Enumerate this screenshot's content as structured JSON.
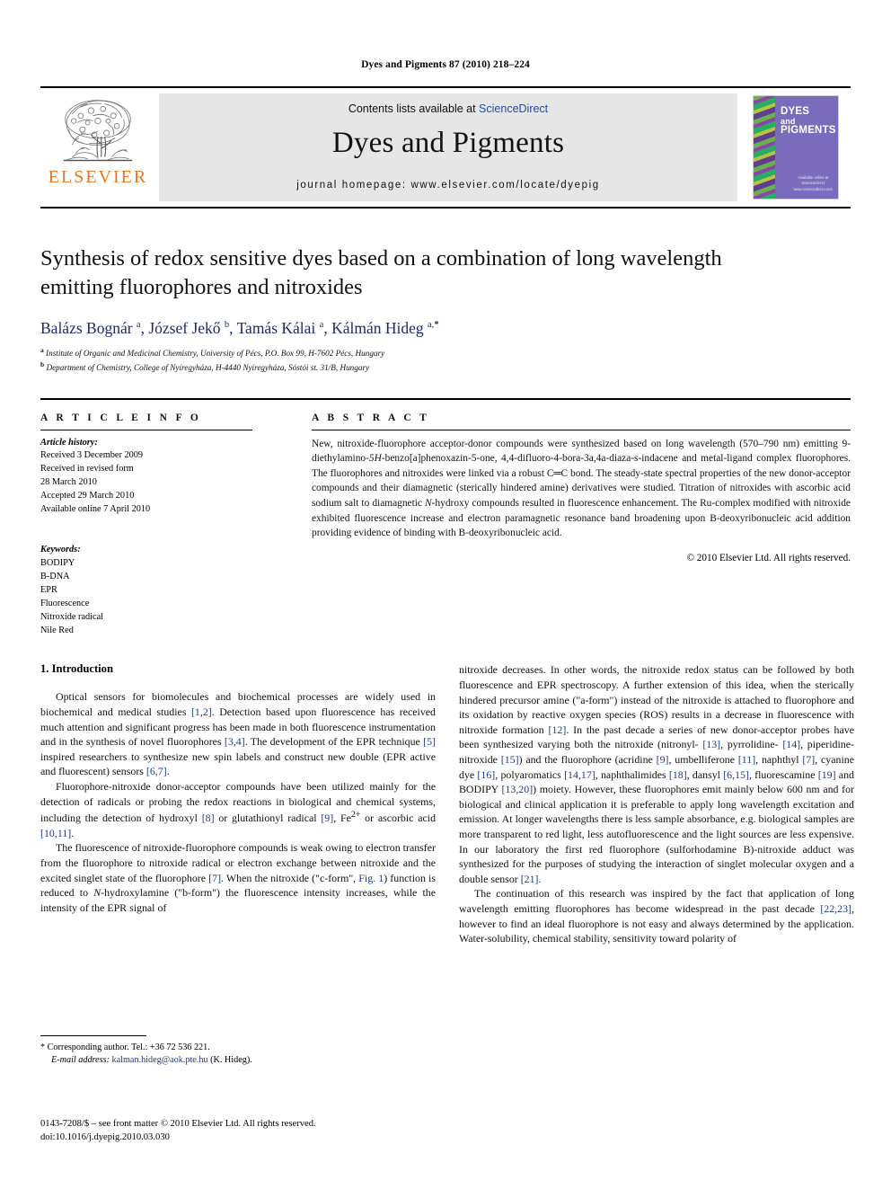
{
  "running_head": "Dyes and Pigments 87 (2010) 218–224",
  "masthead": {
    "publisher_logo_text": "ELSEVIER",
    "contents_prefix": "Contents lists available at ",
    "contents_link": "ScienceDirect",
    "journal_title": "Dyes and Pigments",
    "homepage": "journal homepage: www.elsevier.com/locate/dyepig",
    "cover": {
      "line1": "DYES",
      "line2": "and",
      "line3": "PIGMENTS",
      "footer1": "Available online at",
      "footer2": "ScienceDirect",
      "footer3": "www.sciencedirect.com"
    }
  },
  "article": {
    "title": "Synthesis of redox sensitive dyes based on a combination of long wavelength emitting fluorophores and nitroxides",
    "authors_html": "Balázs Bognár <sup>a</sup>, József Jekő <sup>b</sup>, Tamás Kálai <sup>a</sup>, Kálmán Hideg <sup>a,<b>*</b></sup>",
    "affiliation_a": "Institute of Organic and Medicinal Chemistry, University of Pécs, P.O. Box 99, H-7602 Pécs, Hungary",
    "affiliation_b": "Department of Chemistry, College of Nyíregyháza, H-4440 Nyíregyháza, Sóstói st. 31/B, Hungary"
  },
  "article_info": {
    "heading": "A R T I C L E   I N F O",
    "history_label": "Article history:",
    "history": [
      "Received 3 December 2009",
      "Received in revised form",
      "28 March 2010",
      "Accepted 29 March 2010",
      "Available online 7 April 2010"
    ],
    "keywords_label": "Keywords:",
    "keywords": [
      "BODIPY",
      "B-DNA",
      "EPR",
      "Fluorescence",
      "Nitroxide radical",
      "Nile Red"
    ]
  },
  "abstract": {
    "heading": "A B S T R A C T",
    "text": "New, nitroxide-fluorophore acceptor-donor compounds were synthesized based on long wavelength (570–790 nm) emitting 9-diethylamino-5H-benzo[a]phenoxazin-5-one, 4,4-difluoro-4-bora-3a,4a-diaza-s-indacene and metal-ligand complex fluorophores. The fluorophores and nitroxides were linked via a robust C=C bond. The steady-state spectral properties of the new donor-acceptor compounds and their diamagnetic (sterically hindered amine) derivatives were studied. Titration of nitroxides with ascorbic acid sodium salt to diamagnetic N-hydroxy compounds resulted in fluorescence enhancement. The Ru-complex modified with nitroxide exhibited fluorescence increase and electron paramagnetic resonance band broadening upon B-deoxyribonucleic acid addition providing evidence of binding with B-deoxyribonucleic acid.",
    "copyright": "© 2010 Elsevier Ltd. All rights reserved."
  },
  "introduction": {
    "heading": "1. Introduction",
    "left_paragraphs": [
      "Optical sensors for biomolecules and biochemical processes are widely used in biochemical and medical studies [1,2]. Detection based upon fluorescence has received much attention and significant progress has been made in both fluorescence instrumentation and in the synthesis of novel fluorophores [3,4]. The development of the EPR technique [5] inspired researchers to synthesize new spin labels and construct new double (EPR active and fluorescent) sensors [6,7].",
      "Fluorophore-nitroxide donor-acceptor compounds have been utilized mainly for the detection of radicals or probing the redox reactions in biological and chemical systems, including the detection of hydroxyl [8] or glutathionyl radical [9], Fe2+ or ascorbic acid [10,11].",
      "The fluorescence of nitroxide-fluorophore compounds is weak owing to electron transfer from the fluorophore to nitroxide radical or electron exchange between nitroxide and the excited singlet state of the fluorophore [7]. When the nitroxide (\"c-form\", Fig. 1) function is reduced to N-hydroxylamine (\"b-form\") the fluorescence intensity increases, while the intensity of the EPR signal of"
    ],
    "right_paragraphs": [
      "nitroxide decreases. In other words, the nitroxide redox status can be followed by both fluorescence and EPR spectroscopy. A further extension of this idea, when the sterically hindered precursor amine (\"a-form\") instead of the nitroxide is attached to fluorophore and its oxidation by reactive oxygen species (ROS) results in a decrease in fluorescence with nitroxide formation [12]. In the past decade a series of new donor-acceptor probes have been synthesized varying both the nitroxide (nitronyl- [13], pyrrolidine- [14], piperidine-nitroxide [15]) and the fluorophore (acridine [9], umbelliferone [11], naphthyl [7], cyanine dye [16], polyaromatics [14,17], naphthalimides [18], dansyl [6,15], fluorescamine [19] and BODIPY [13,20]) moiety. However, these fluorophores emit mainly below 600 nm and for biological and clinical application it is preferable to apply long wavelength excitation and emission. At longer wavelengths there is less sample absorbance, e.g. biological samples are more transparent to red light, less autofluorescence and the light sources are less expensive. In our laboratory the first red fluorophore (sulforhodamine B)-nitroxide adduct was synthesized for the purposes of studying the interaction of singlet molecular oxygen and a double sensor [21].",
      "The continuation of this research was inspired by the fact that application of long wavelength emitting fluorophores has become widespread in the past decade [22,23], however to find an ideal fluorophore is not easy and always determined by the application. Water-solubility, chemical stability, sensitivity toward polarity of"
    ]
  },
  "footnotes": {
    "corresponding": "* Corresponding author. Tel.: +36 72 536 221.",
    "email_label": "E-mail address:",
    "email": "kalman.hideg@aok.pte.hu",
    "email_suffix": " (K. Hideg).",
    "imprint_line1": "0143-7208/$ – see front matter © 2010 Elsevier Ltd. All rights reserved.",
    "imprint_line2": "doi:10.1016/j.dyepig.2010.03.030"
  }
}
